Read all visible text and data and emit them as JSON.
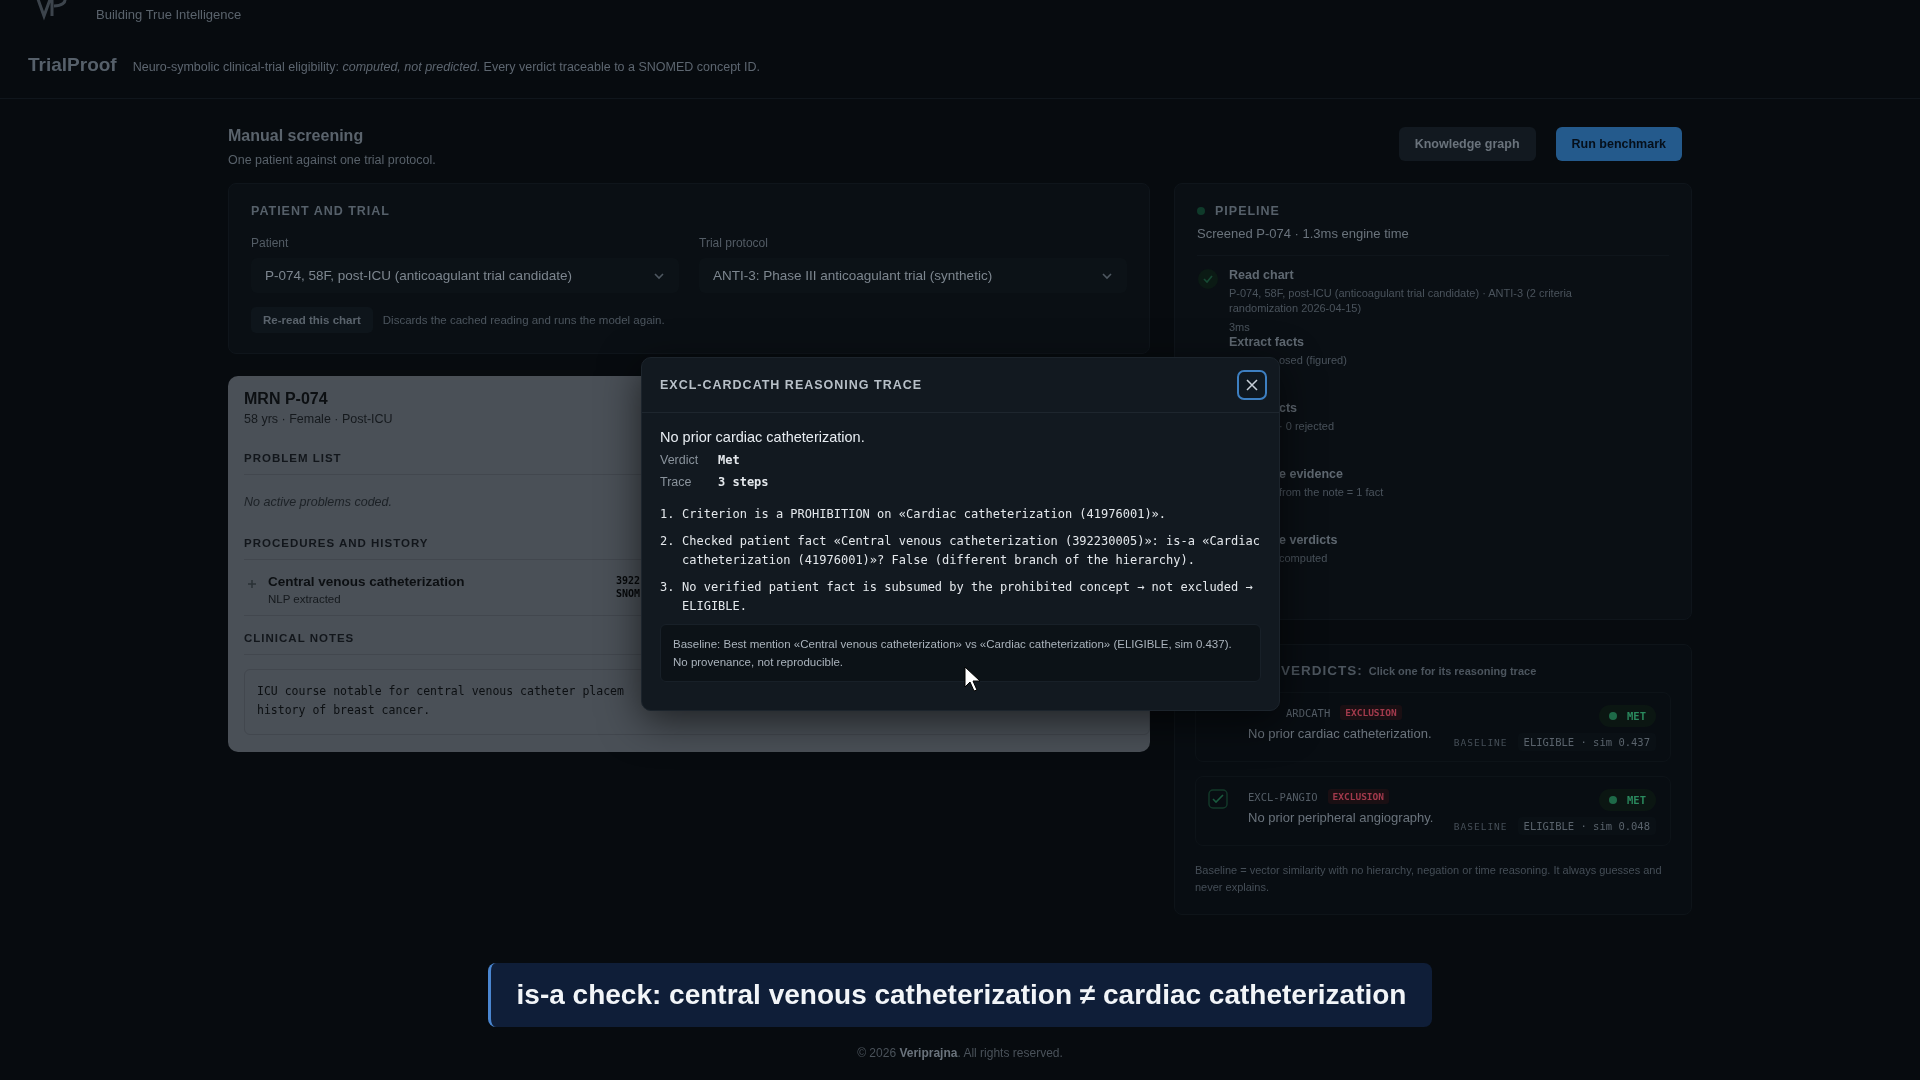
{
  "brand": {
    "tagline": "Building True Intelligence"
  },
  "app": {
    "title": "TrialProof",
    "description": "Neuro-symbolic clinical-trial eligibility: *computed, not predicted*. Every verdict traceable to a SNOMED concept ID."
  },
  "page": {
    "title": "Manual screening",
    "subtitle": "One patient against one trial protocol.",
    "buttons": [
      {
        "label": "Knowledge graph",
        "kind": "secondary"
      },
      {
        "label": "Run benchmark",
        "kind": "primary"
      }
    ]
  },
  "selection": {
    "title": "PATIENT AND TRIAL",
    "fields": [
      {
        "label": "Patient",
        "value": "P-074, 58F, post-ICU (anticoagulant trial candidate)"
      },
      {
        "label": "Trial protocol",
        "value": "ANTI-3: Phase III anticoagulant trial (synthetic)"
      }
    ],
    "reread_button": "Re-read this chart",
    "reread_hint": "Discards the cached reading and runs the model again."
  },
  "patient": {
    "mrn": "MRN P-074",
    "demographics": "58 yrs · Female · Post-ICU",
    "problem_title": "PROBLEM LIST",
    "problem_empty": "No active problems coded.",
    "procedures_title": "PROCEDURES AND HISTORY",
    "procedures": [
      {
        "name": "Central venous catheterization",
        "source": "NLP extracted",
        "code": "3922",
        "system": "SNOM"
      }
    ],
    "notes_title": "CLINICAL NOTES",
    "notes_lines": [
      "ICU course notable for central venous catheter placem",
      "history of breast cancer."
    ]
  },
  "pipeline": {
    "title": "PIPELINE",
    "summary": "Screened P-074 · 1.3ms engine time",
    "steps": [
      {
        "kind": "full",
        "done": true,
        "title": "Read chart",
        "detail": "P-074, 58F, post-ICU (anticoagulant trial candidate) · ANTI-3 (2 criteria randomization 2026-04-15)",
        "time": "3ms"
      },
      {
        "kind": "partial",
        "title": "Extract facts",
        "detail": "osed (figured)"
      },
      {
        "kind": "clipped",
        "title": "cts",
        "detail": "· 0 rejected"
      },
      {
        "kind": "clipped",
        "title": "e evidence",
        "detail": "from the note = 1 fact"
      },
      {
        "kind": "clipped",
        "title": "e verdicts",
        "detail": "computed"
      }
    ]
  },
  "verdicts": {
    "title": "VERDICTS:",
    "hint": "Click one for its reasoning trace",
    "items": [
      {
        "kind": "clipped",
        "id": "ARDCATH",
        "type": "EXCLUSION",
        "text": "No prior cardiac catheterization.",
        "verdict": "MET",
        "baseline_label": "BASELINE",
        "baseline": "ELIGIBLE · sim 0.437"
      },
      {
        "kind": "full",
        "checked": true,
        "id": "EXCL-PANGIO",
        "type": "EXCLUSION",
        "text": "No prior peripheral angiography.",
        "verdict": "MET",
        "baseline_label": "BASELINE",
        "baseline": "ELIGIBLE · sim 0.048"
      }
    ],
    "note": "Baseline = vector similarity with no hierarchy, negation or time reasoning. It always guesses and never explains."
  },
  "modal": {
    "title": "EXCL-CARDCATH REASONING TRACE",
    "criterion": "No prior cardiac catheterization.",
    "facts": [
      {
        "label": "Verdict",
        "value": "Met"
      },
      {
        "label": "Trace",
        "value": "3 steps"
      }
    ],
    "steps": [
      {
        "number": "1.",
        "text": "Criterion is a PROHIBITION on «Cardiac catheterization (41976001)»."
      },
      {
        "number": "2.",
        "text": "Checked patient fact «Central venous catheterization (392230005)»: is-a «Cardiac catheterization (41976001)»? False (different branch of the hierarchy)."
      },
      {
        "number": "3.",
        "text": "No verified patient fact is subsumed by the prohibited concept → not excluded → ELIGIBLE."
      }
    ],
    "baseline": "Baseline: Best mention «Central venous catheterization» vs «Cardiac catheterization» (ELIGIBLE, sim 0.437). No provenance, not reproducible."
  },
  "caption": "is-a check: central venous catheterization ≠ cardiac catheterization",
  "footer": "© 2026 **Veriprajna**. All rights reserved."
}
